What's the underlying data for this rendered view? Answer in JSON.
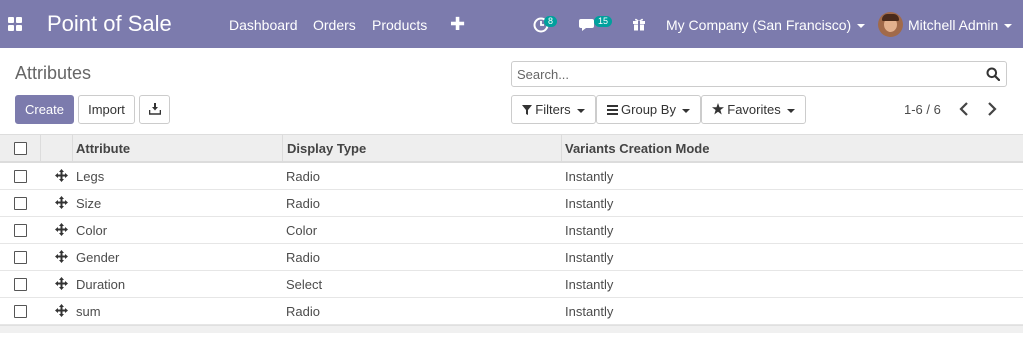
{
  "navbar": {
    "brand": "Point of Sale",
    "menus": [
      "Dashboard",
      "Orders",
      "Products"
    ],
    "activity_badge": "8",
    "messages_badge": "15",
    "company": "My Company (San Francisco)",
    "user": "Mitchell Admin",
    "accent_color": "#7c7bad"
  },
  "control_panel": {
    "title": "Attributes",
    "search_placeholder": "Search...",
    "create_label": "Create",
    "import_label": "Import",
    "filters_label": "Filters",
    "groupby_label": "Group By",
    "favorites_label": "Favorites",
    "pager": "1-6 / 6"
  },
  "table": {
    "columns": [
      "Attribute",
      "Display Type",
      "Variants Creation Mode"
    ],
    "rows": [
      {
        "attribute": "Legs",
        "display_type": "Radio",
        "mode": "Instantly"
      },
      {
        "attribute": "Size",
        "display_type": "Radio",
        "mode": "Instantly"
      },
      {
        "attribute": "Color",
        "display_type": "Color",
        "mode": "Instantly"
      },
      {
        "attribute": "Gender",
        "display_type": "Radio",
        "mode": "Instantly"
      },
      {
        "attribute": "Duration",
        "display_type": "Select",
        "mode": "Instantly"
      },
      {
        "attribute": "sum",
        "display_type": "Radio",
        "mode": "Instantly"
      }
    ]
  }
}
